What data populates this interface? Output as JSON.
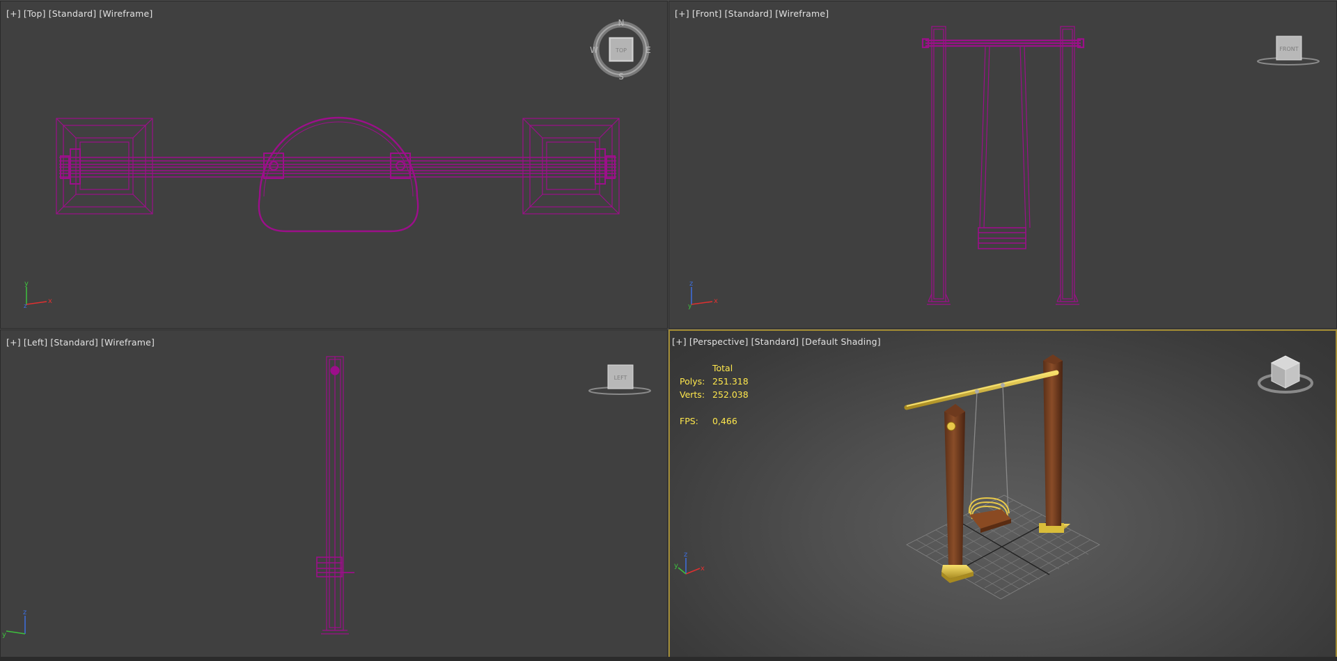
{
  "viewports": {
    "top": {
      "label": [
        "[+]",
        "[Top]",
        "[Standard]",
        "[Wireframe]"
      ],
      "viewcube": {
        "face": "TOP",
        "compass": {
          "n": "N",
          "s": "S",
          "e": "E",
          "w": "W"
        }
      },
      "axis": {
        "up": "y",
        "right": "x"
      }
    },
    "front": {
      "label": [
        "[+]",
        "[Front]",
        "[Standard]",
        "[Wireframe]"
      ],
      "viewcube": {
        "face": "FRONT"
      },
      "axis": {
        "up": "z",
        "right": "x"
      }
    },
    "left": {
      "label": [
        "[+]",
        "[Left]",
        "[Standard]",
        "[Wireframe]"
      ],
      "viewcube": {
        "face": "LEFT"
      },
      "axis": {
        "up": "z",
        "right": "y"
      }
    },
    "perspective": {
      "label": [
        "[+]",
        "[Perspective]",
        "[Standard]",
        "[Default Shading]"
      ],
      "stats": {
        "header": "Total",
        "polys_label": "Polys:",
        "polys": "251.318",
        "verts_label": "Verts:",
        "verts": "252.038",
        "fps_label": "FPS:",
        "fps": "0,466"
      },
      "axis": {
        "up": "z",
        "right": "x",
        "depth": "y"
      }
    }
  },
  "colors": {
    "wireframe": "#9c0f8a",
    "stats_text": "#ffe84d",
    "active_border": "#a08a33",
    "viewport_bg": "#404040"
  }
}
